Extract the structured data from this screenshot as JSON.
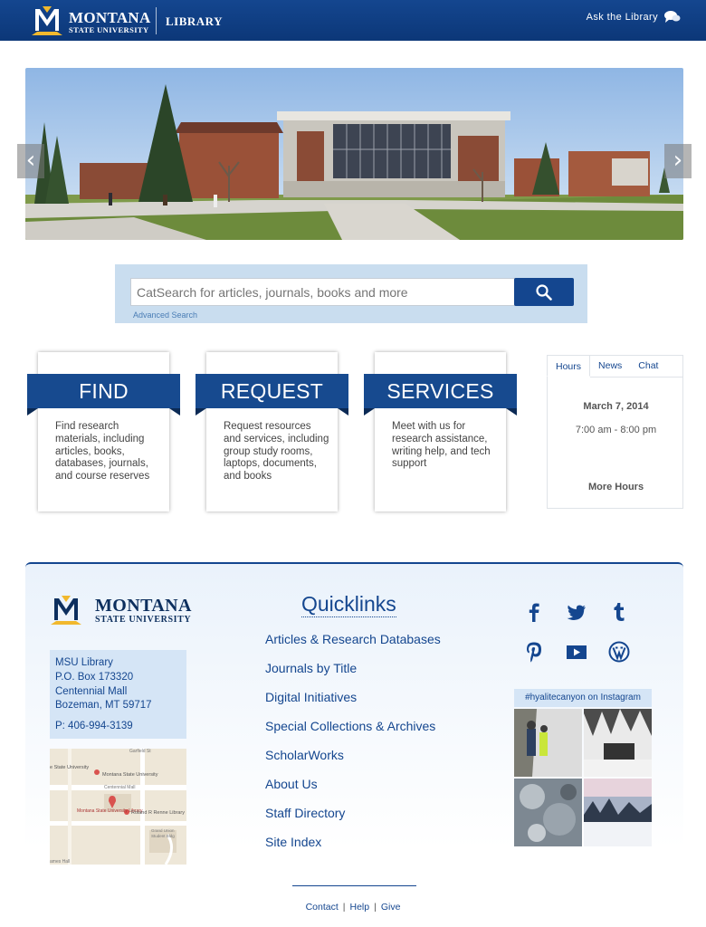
{
  "header": {
    "logo_line1": "MONTANA",
    "logo_line2": "STATE UNIVERSITY",
    "library_label": "LIBRARY",
    "ask_label": "Ask the Library",
    "bg_color": "#0c3778",
    "gold_color": "#f1b82d"
  },
  "carousel": {
    "prev_label": "‹",
    "next_label": "›"
  },
  "search": {
    "placeholder": "CatSearch for articles, journals, books and more",
    "advanced_label": "Advanced Search"
  },
  "cards": [
    {
      "title": "FIND",
      "description": "Find research materials, including articles, books, databases, journals, and course reserves"
    },
    {
      "title": "REQUEST",
      "description": "Request resources and services, including group study rooms, laptops, documents, and books"
    },
    {
      "title": "SERVICES",
      "description": "Meet with us for research assistance, writing help, and tech support"
    }
  ],
  "hours_widget": {
    "tabs": [
      "Hours",
      "News",
      "Chat"
    ],
    "active_tab": "Hours",
    "date": "March 7, 2014",
    "time": "7:00 am - 8:00 pm",
    "more_label": "More Hours"
  },
  "footer": {
    "logo_line1": "MONTANA",
    "logo_line2": "STATE UNIVERSITY",
    "address": {
      "line1": "MSU Library",
      "line2": "P.O. Box 173320",
      "line3": "Centennial Mall",
      "line4": "Bozeman, MT 59717",
      "phone": "P: 406-994-3139"
    },
    "map_labels": {
      "campus": "e State University",
      "msu_pin": "Montana State University",
      "mall": "Centennial Mall",
      "library_pin": "Montana State University Library",
      "renne": "Roland R Renne Library",
      "garfield": "Garfield St",
      "gym": "Grand Union",
      "bldg": "Student Bldg",
      "lower": "ames Hall"
    },
    "quicklinks_title": "Quicklinks",
    "quicklinks": [
      "Articles & Research Databases",
      "Journals by Title",
      "Digital Initiatives",
      "Special Collections & Archives",
      "ScholarWorks",
      "About Us",
      "Staff Directory",
      "Site Index"
    ],
    "social": [
      "facebook-icon",
      "twitter-icon",
      "tumblr-icon",
      "pinterest-icon",
      "youtube-icon",
      "wordpress-icon"
    ],
    "instagram_title": "#hyalitecanyon on Instagram"
  },
  "bottom_links": [
    "Contact",
    "Help",
    "Give"
  ]
}
